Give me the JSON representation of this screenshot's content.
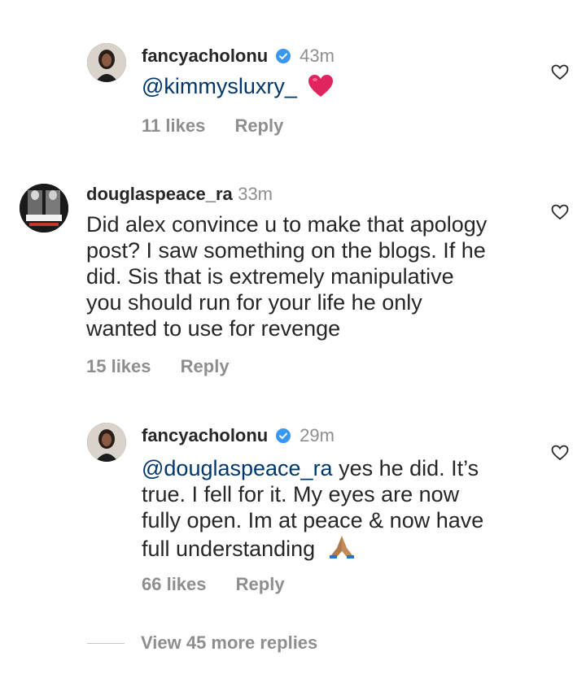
{
  "comments": [
    {
      "username": "fancyacholonu",
      "verified": true,
      "time": "43m",
      "mention": "@kimmysluxry_",
      "text": "",
      "emoji": "❤️",
      "likes": "11 likes",
      "reply": "Reply"
    },
    {
      "username": "douglaspeace_ra",
      "verified": false,
      "time": "33m",
      "mention": "",
      "text_lines": [
        "Did alex convince u to make that apology",
        "post? I saw something on the blogs. If he",
        "did. Sis that is extremely manipulative",
        "you should run for your life he only",
        "wanted to use for revenge"
      ],
      "likes": "15 likes",
      "reply": "Reply"
    },
    {
      "username": "fancyacholonu",
      "verified": true,
      "time": "29m",
      "mention": "@douglaspeace_ra",
      "text_first": " yes he did. It’s",
      "text_lines": [
        "true. I fell for it. My eyes are now",
        "fully open. Im at peace & now have",
        "full understanding"
      ],
      "emoji": "🙏🏽",
      "likes": "66 likes",
      "reply": "Reply"
    }
  ],
  "view_more": "View 45 more replies",
  "icons": {
    "heart": "heart-outline-icon",
    "verified": "verified-badge-icon"
  },
  "colors": {
    "verified": "#3897f0",
    "mention": "#00376b",
    "muted": "#8e8e8e",
    "heart_emoji": "#e0245e"
  }
}
